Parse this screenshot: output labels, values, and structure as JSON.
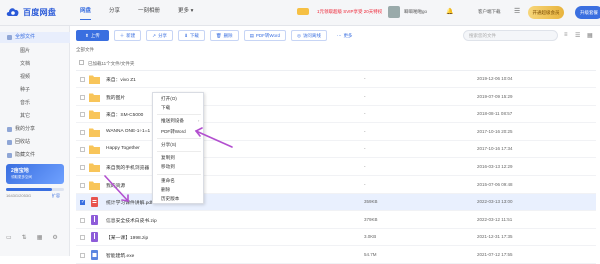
{
  "app": {
    "logo_text": "百度网盘",
    "nav": [
      "网盘",
      "分享",
      "一刻相册",
      "更多"
    ],
    "promo": "1元领取超级 SVIP享受 20天特权",
    "username": "噼噼啪啪go",
    "customer_service": "客户端下载",
    "vip_button": "开通超级会员",
    "svip_button": "升级套餐"
  },
  "sidebar": {
    "items": [
      {
        "label": "全部文件",
        "active": true,
        "sub": false
      },
      {
        "label": "图片",
        "sub": true
      },
      {
        "label": "文档",
        "sub": true
      },
      {
        "label": "视频",
        "sub": true
      },
      {
        "label": "种子",
        "sub": true
      },
      {
        "label": "音乐",
        "sub": true
      },
      {
        "label": "其它",
        "sub": true
      },
      {
        "label": "我的分享",
        "sub": false
      },
      {
        "label": "回收站",
        "sub": false
      },
      {
        "label": "隐藏文件",
        "sub": false
      }
    ],
    "quota_banner_title": "2亩宝地",
    "quota_banner_sub": "领取更多空间",
    "quota_text": "1643G/2053G",
    "quota_fraction": 0.8,
    "expand": "扩容"
  },
  "toolbar": {
    "buttons": [
      "上传",
      "新建",
      "分享",
      "下载",
      "删除",
      "PDF转Word",
      "访问离线",
      "更多"
    ],
    "search_placeholder": "搜索您的文件"
  },
  "list": {
    "breadcrumb": "全部文件",
    "loaded_text": "已加载11个文件/文件夹",
    "rows": [
      {
        "name": "来自：vivo Z1",
        "size": "-",
        "time": "2019-12-06 10:04",
        "type": "folder"
      },
      {
        "name": "我的图片",
        "size": "-",
        "time": "2019-07-09 15:29",
        "type": "folder"
      },
      {
        "name": "来自：SM-C5000",
        "size": "-",
        "time": "2018-08-11 08:57",
        "type": "folder"
      },
      {
        "name": "WANNA ONE-1÷1=1",
        "size": "-",
        "time": "2017-10-16 20:25",
        "type": "folder"
      },
      {
        "name": "Happy Together",
        "size": "-",
        "time": "2017-10-16 17:34",
        "type": "folder"
      },
      {
        "name": "来自我的手机浏览器",
        "size": "-",
        "time": "2016-03-13 12:29",
        "type": "folder"
      },
      {
        "name": "我的资源",
        "size": "-",
        "time": "2015-07-06 09:48",
        "type": "folder"
      },
      {
        "name": "统计学习课件讲解.pdf",
        "size": "359KB",
        "time": "2022-03-13 13:00",
        "type": "pdf",
        "selected": true
      },
      {
        "name": "信息安全技术白皮书.zip",
        "size": "379KB",
        "time": "2022-03-12 11:51",
        "type": "zip"
      },
      {
        "name": "【某一课】1998.zip",
        "size": "3.0KB",
        "time": "2021-12-31 17:35",
        "type": "zip"
      },
      {
        "name": "智能建筑.exe",
        "size": "54.7M",
        "time": "2021-07-12 17:55",
        "type": "exe"
      }
    ]
  },
  "context_menu": {
    "items": [
      "打开(O)",
      "下载",
      "推送到设备",
      "PDF转Word",
      "分享(S)",
      "复制到",
      "移动到",
      "重命名",
      "删除",
      "历史版本"
    ]
  },
  "colors": {
    "accent": "#3a6fe0",
    "folder": "#f8c55a",
    "annotation": "#b24fcf"
  }
}
